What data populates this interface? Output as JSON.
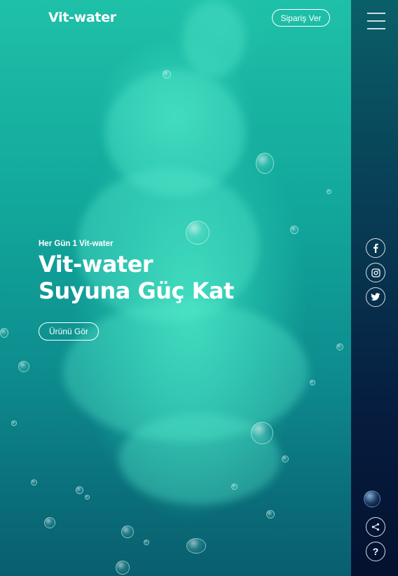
{
  "header": {
    "logo": "Vit-water",
    "order_button": "Sipariş Ver"
  },
  "hero": {
    "eyebrow": "Her Gün 1 Vit-water",
    "headline_line1": "Vit-water",
    "headline_line2": "Suyuna Güç Kat",
    "cta_button": "Ürünü Gör"
  },
  "sidebar": {
    "icons": [
      "menu-icon",
      "facebook-icon",
      "instagram-icon",
      "twitter-icon",
      "share-icon",
      "help-icon"
    ],
    "help_glyph": "?"
  },
  "colors": {
    "water_top": "#1fc0a8",
    "water_bottom": "#095e6e",
    "sidebar_top": "#0a5f68",
    "sidebar_bottom": "#04112f",
    "text": "#ffffff"
  }
}
